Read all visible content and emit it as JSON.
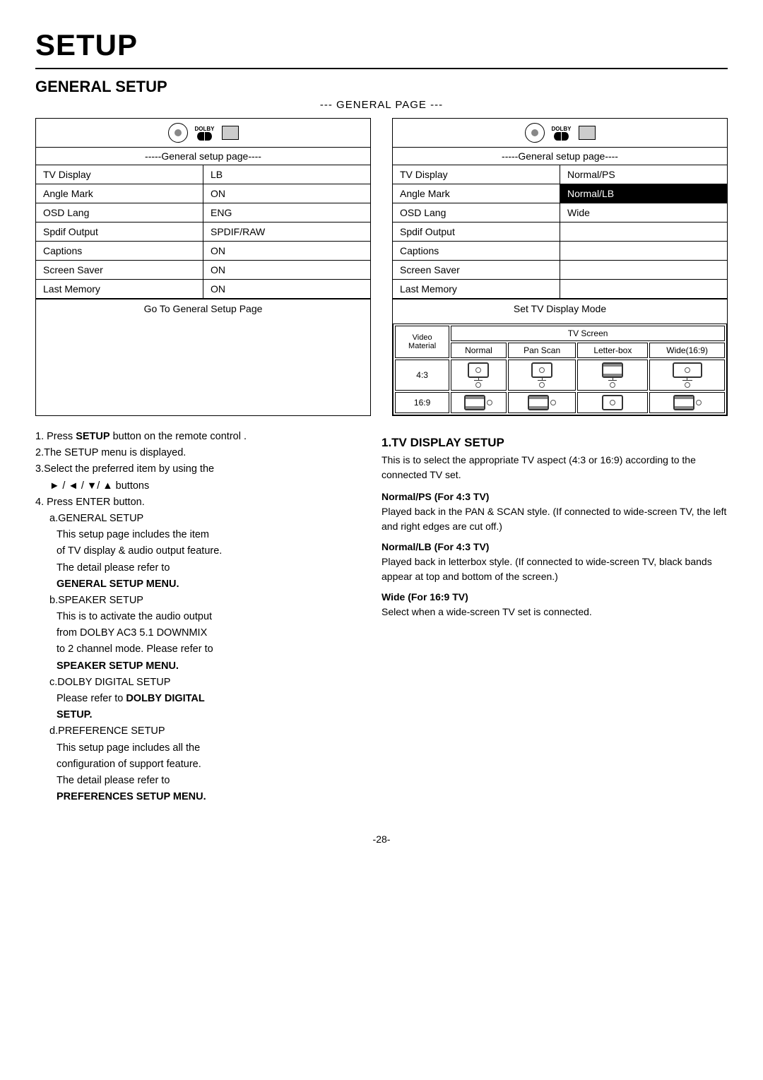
{
  "title": "SETUP",
  "section": "GENERAL SETUP",
  "page_label": "--- GENERAL PAGE ---",
  "left_box": {
    "subtitle": "-----General setup page----",
    "rows": [
      {
        "label": "TV Display",
        "value": "LB"
      },
      {
        "label": "Angle Mark",
        "value": "ON"
      },
      {
        "label": "OSD Lang",
        "value": "ENG"
      },
      {
        "label": "Spdif Output",
        "value": "SPDIF/RAW"
      },
      {
        "label": "Captions",
        "value": "ON"
      },
      {
        "label": "Screen Saver",
        "value": "ON"
      },
      {
        "label": "Last Memory",
        "value": "ON"
      }
    ],
    "footer": "Go To General Setup Page"
  },
  "right_box": {
    "subtitle": "-----General setup page----",
    "rows": [
      {
        "label": "TV Display",
        "value": "Normal/PS"
      },
      {
        "label": "Angle Mark",
        "value": "Normal/LB",
        "highlight": true
      },
      {
        "label": "OSD Lang",
        "value": "Wide"
      },
      {
        "label": "Spdif Output",
        "value": ""
      },
      {
        "label": "Captions",
        "value": ""
      },
      {
        "label": "Screen Saver",
        "value": ""
      },
      {
        "label": "Last Memory",
        "value": ""
      }
    ],
    "footer": "Set TV Display Mode"
  },
  "instructions": {
    "items": [
      "1. Press SETUP button on the remote control .",
      "2.The SETUP menu is displayed.",
      "3.Select the preferred item by using the",
      "► / ◄ / ▼/ ▲ buttons",
      "4. Press ENTER button.",
      "a.GENERAL SETUP",
      "This setup page includes the item",
      "of TV display & audio output feature.",
      "The detail please refer to",
      "GENERAL SETUP MENU.",
      "b.SPEAKER SETUP",
      "This is to activate the audio output",
      "from DOLBY AC3 5.1 DOWNMIX",
      "to 2 channel mode.  Please refer to",
      "SPEAKER SETUP MENU.",
      "c.DOLBY DIGITAL SETUP",
      "Please refer to DOLBY DIGITAL",
      "SETUP.",
      "d.PREFERENCE SETUP",
      "This setup page includes all the",
      "configuration of support feature.",
      "The detail please refer to",
      "PREFERENCES SETUP MENU."
    ]
  },
  "tv_display_section": {
    "title": "1.TV DISPLAY SETUP",
    "intro": "This is to select the appropriate TV aspect (4:3 or 16:9) according to the connected TV set.",
    "subsections": [
      {
        "head": "Normal/PS (For 4:3 TV)",
        "text": "Played back in the PAN & SCAN style. (If connected to wide-screen TV, the left and right edges are cut off.)"
      },
      {
        "head": "Normal/LB (For 4:3 TV)",
        "text": "Played back in letterbox style. (If connected to wide-screen TV, black bands appear at top and bottom of the screen.)"
      },
      {
        "head": "Wide (For 16:9 TV)",
        "text": "Select when a wide-screen TV set is connected."
      }
    ],
    "table": {
      "header_left": "Video\nMaterial",
      "header_col": "TV Screen",
      "cols": [
        "Normal",
        "Pan Scan",
        "Letter-box",
        "Wide(16:9)"
      ],
      "rows": [
        {
          "label": "4:3",
          "type": "circle"
        },
        {
          "label": "16:9",
          "type": "wide"
        }
      ]
    }
  },
  "page_number": "-28-"
}
